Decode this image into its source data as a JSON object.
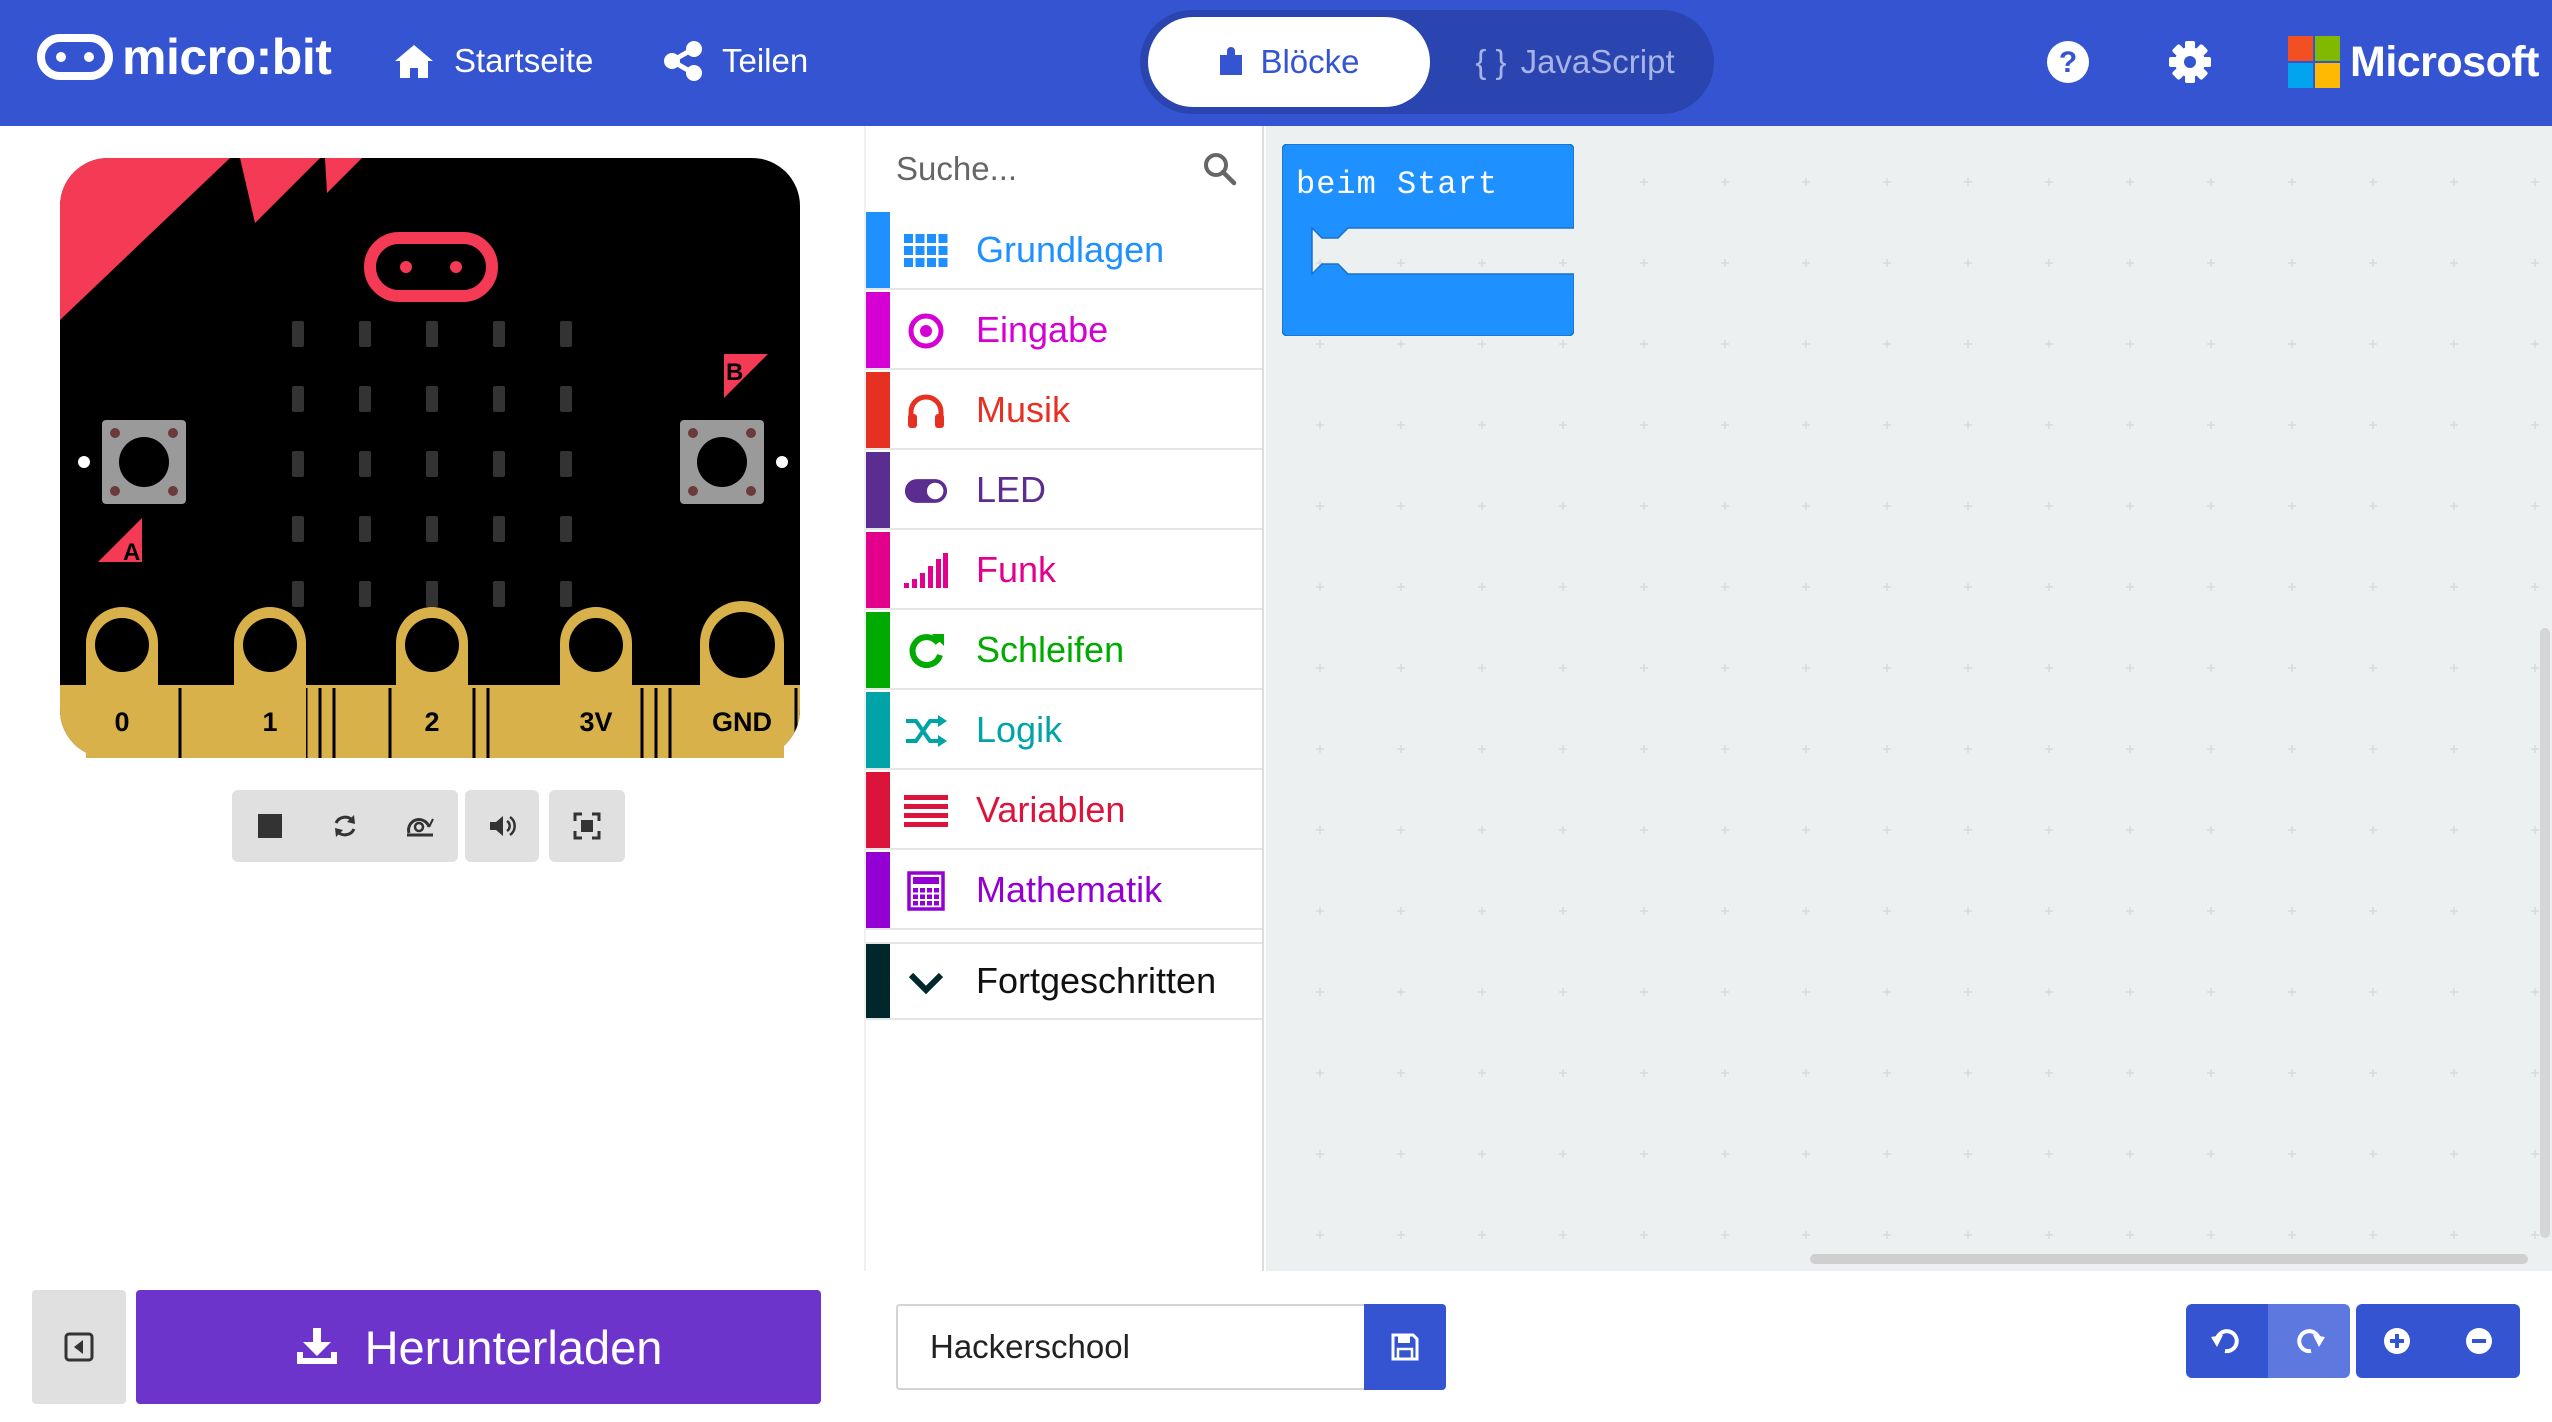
{
  "header": {
    "logo_text": "micro:bit",
    "nav": {
      "home_label": "Startseite",
      "share_label": "Teilen"
    },
    "editor_toggle": {
      "blocks_label": "Blöcke",
      "javascript_label": "JavaScript",
      "js_brackets": "{ }",
      "active": "blocks"
    },
    "brand": "Microsoft",
    "colors": {
      "background": "#3454d1",
      "toggle_bg": "#2a45b0"
    }
  },
  "simulator": {
    "board_color": "#000000",
    "accent": "#f43a55",
    "pin_gold": "#d8b14a",
    "button_a_label": "A",
    "button_b_label": "B",
    "pins": [
      "0",
      "1",
      "2",
      "3V",
      "GND"
    ],
    "controls": [
      "stop-icon",
      "restart-icon",
      "slowmo-icon",
      "mute-icon",
      "fullscreen-icon"
    ]
  },
  "toolbox": {
    "search_placeholder": "Suche...",
    "categories": [
      {
        "label": "Grundlagen",
        "color": "#1e90ff",
        "icon": "grid-icon"
      },
      {
        "label": "Eingabe",
        "color": "#d400d4",
        "icon": "target-icon"
      },
      {
        "label": "Musik",
        "color": "#e63022",
        "icon": "headphones-icon"
      },
      {
        "label": "LED",
        "color": "#5c2d91",
        "icon": "toggle-icon"
      },
      {
        "label": "Funk",
        "color": "#e3008c",
        "icon": "signal-bars-icon"
      },
      {
        "label": "Schleifen",
        "color": "#00aa00",
        "icon": "loop-arrow-icon"
      },
      {
        "label": "Logik",
        "color": "#00a4a6",
        "icon": "shuffle-icon"
      },
      {
        "label": "Variablen",
        "color": "#dc143c",
        "icon": "lines-icon"
      },
      {
        "label": "Mathematik",
        "color": "#9400d3",
        "icon": "calculator-icon"
      }
    ],
    "advanced": {
      "label": "Fortgeschritten",
      "color": "#00272b",
      "icon": "chevron-down-icon"
    }
  },
  "workspace": {
    "block_label": "beim Start",
    "block_color": "#1e90ff",
    "background": "#ecf0f1"
  },
  "footer": {
    "download_label": "Herunterladen",
    "download_color": "#6d34cc",
    "project_name": "Hackerschool"
  }
}
